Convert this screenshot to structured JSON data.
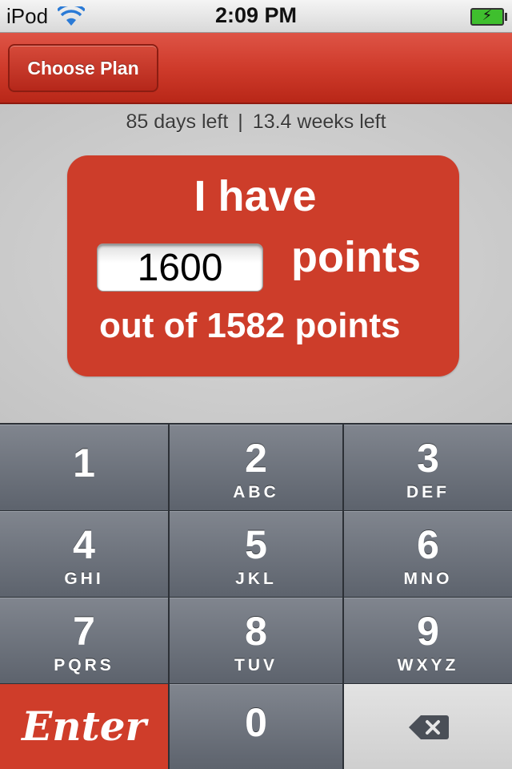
{
  "status_bar": {
    "carrier": "iPod",
    "time": "2:09 PM",
    "wifi_icon": "wifi-icon",
    "battery_icon": "battery-charging-icon"
  },
  "nav": {
    "choose_plan": "Choose Plan"
  },
  "summary": {
    "days_left": "85 days left",
    "separator": "|",
    "weeks_left": "13.4 weeks left"
  },
  "card": {
    "line1": "I have",
    "points_value": "1600",
    "points_label": "points",
    "line3": "out of 1582 points"
  },
  "keypad": {
    "keys": [
      {
        "digit": "1",
        "letters": ""
      },
      {
        "digit": "2",
        "letters": "ABC"
      },
      {
        "digit": "3",
        "letters": "DEF"
      },
      {
        "digit": "4",
        "letters": "GHI"
      },
      {
        "digit": "5",
        "letters": "JKL"
      },
      {
        "digit": "6",
        "letters": "MNO"
      },
      {
        "digit": "7",
        "letters": "PQRS"
      },
      {
        "digit": "8",
        "letters": "TUV"
      },
      {
        "digit": "9",
        "letters": "WXYZ"
      }
    ],
    "enter_label": "Enter",
    "zero": "0",
    "delete_icon": "backspace-icon"
  },
  "colors": {
    "brand_red": "#cd3d2a",
    "nav_red": "#cf3b2b",
    "keypad_gray": "#5d636d"
  }
}
